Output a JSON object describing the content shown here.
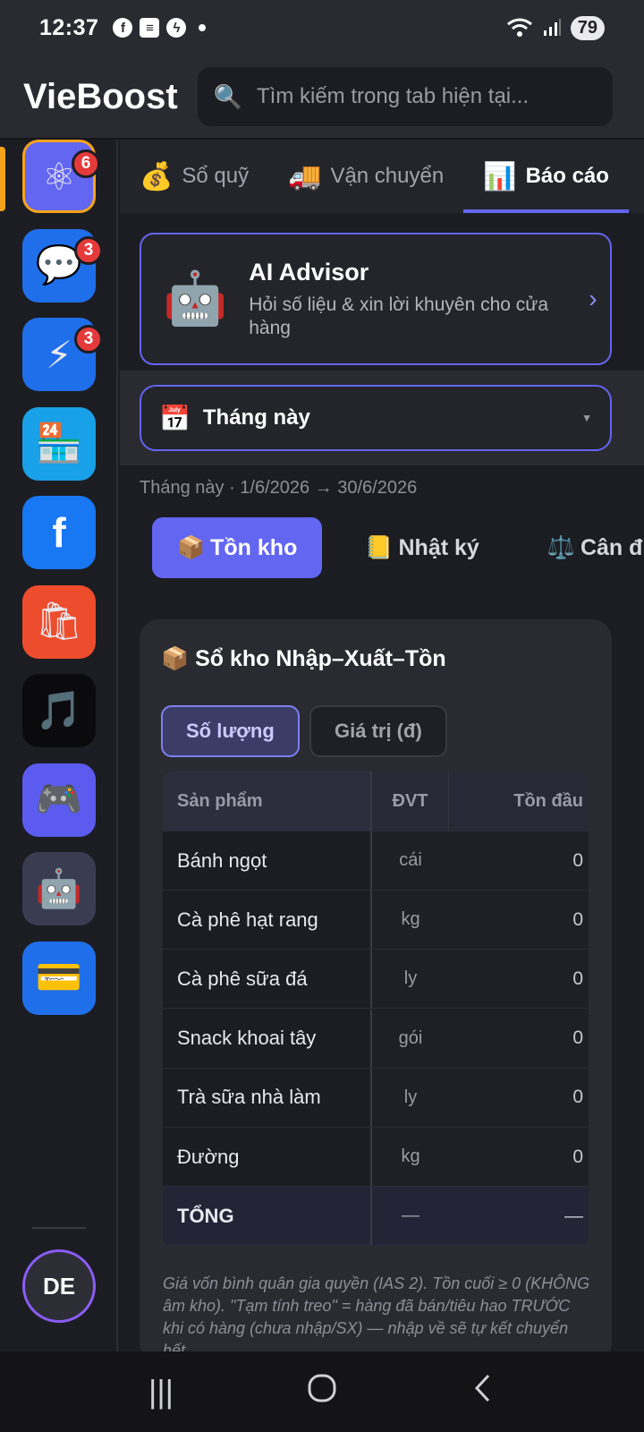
{
  "status": {
    "time": "12:37",
    "battery": "79"
  },
  "header": {
    "title": "VieBoost",
    "search_placeholder": "Tìm kiếm trong tab hiện tại..."
  },
  "sidebar": {
    "apps": [
      {
        "name": "network-app",
        "icon": "⚛",
        "bg": "#6366f1",
        "badge": "6",
        "active": true
      },
      {
        "name": "messages-app",
        "icon": "💬",
        "bg": "#1f6feb",
        "badge": "3"
      },
      {
        "name": "flash-app",
        "icon": "⚡",
        "bg": "#1f6feb",
        "badge": "3"
      },
      {
        "name": "store-app",
        "icon": "🏪",
        "bg": "#18a0e8",
        "badge": ""
      },
      {
        "name": "facebook-app",
        "icon": "f",
        "bg": "#1877f2",
        "badge": ""
      },
      {
        "name": "shopping-app",
        "icon": "🛍",
        "bg": "#ee4d2d",
        "badge": ""
      },
      {
        "name": "tiktok-app",
        "icon": "🎵",
        "bg": "#0b0b0e",
        "badge": ""
      },
      {
        "name": "game-app",
        "icon": "🎮",
        "bg": "#5b5bf0",
        "badge": ""
      },
      {
        "name": "bot-app",
        "icon": "🤖",
        "bg": "#3a3d52",
        "badge": ""
      },
      {
        "name": "card-app",
        "icon": "💳",
        "bg": "#1f6feb",
        "badge": ""
      }
    ],
    "avatar": "DE"
  },
  "tabs": [
    {
      "icon": "💰",
      "label": "Sổ quỹ"
    },
    {
      "icon": "🚚",
      "label": "Vận chuyển"
    },
    {
      "icon": "📊",
      "label": "Báo cáo",
      "active": true
    }
  ],
  "ai_advisor": {
    "title": "AI Advisor",
    "subtitle": "Hỏi số liệu & xin lời khuyên cho cửa hàng"
  },
  "period": {
    "label": "Tháng này",
    "range": "Tháng này · 1/6/2026 → 30/6/2026"
  },
  "subtabs": [
    {
      "icon": "📦",
      "label": "Tồn kho",
      "active": true
    },
    {
      "icon": "📒",
      "label": "Nhật ký"
    },
    {
      "icon": "⚖️",
      "label": "Cân đ"
    }
  ],
  "ledger": {
    "title": "📦 Sổ kho Nhập–Xuất–Tồn",
    "toggle_qty": "Số lượng",
    "toggle_value": "Giá trị (đ)",
    "columns": [
      "Sản phẩm",
      "ĐVT",
      "Tồn đầu"
    ],
    "rows": [
      {
        "name": "Bánh ngọt",
        "unit": "cái",
        "open": "0"
      },
      {
        "name": "Cà phê hạt rang",
        "unit": "kg",
        "open": "0"
      },
      {
        "name": "Cà phê sữa đá",
        "unit": "ly",
        "open": "0"
      },
      {
        "name": "Snack khoai tây",
        "unit": "gói",
        "open": "0"
      },
      {
        "name": "Trà sữa nhà làm",
        "unit": "ly",
        "open": "0"
      },
      {
        "name": "Đường",
        "unit": "kg",
        "open": "0"
      }
    ],
    "total": {
      "name": "TỔNG",
      "unit": "—",
      "open": "—"
    },
    "footnote": "Giá vốn bình quân gia quyền (IAS 2). Tồn cuối ≥ 0 (KHÔNG âm kho). \"Tạm tính treo\" = hàng đã bán/tiêu hao TRƯỚC khi có hàng (chưa nhập/SX) — nhập về sẽ tự kết chuyển hết"
  }
}
